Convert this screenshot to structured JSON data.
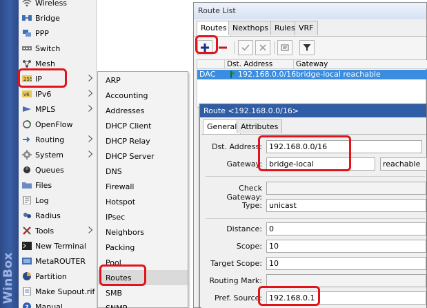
{
  "brand": {
    "text": "WinBox"
  },
  "main_menu": [
    {
      "label": "Wireless",
      "icon": "wireless-icon",
      "arrow": false
    },
    {
      "label": "Bridge",
      "icon": "bridge-icon",
      "arrow": false
    },
    {
      "label": "PPP",
      "icon": "ppp-icon",
      "arrow": false
    },
    {
      "label": "Switch",
      "icon": "switch-icon",
      "arrow": false
    },
    {
      "label": "Mesh",
      "icon": "mesh-icon",
      "arrow": false
    },
    {
      "label": "IP",
      "icon": "ip-icon",
      "arrow": true
    },
    {
      "label": "IPv6",
      "icon": "ipv6-icon",
      "arrow": true
    },
    {
      "label": "MPLS",
      "icon": "mpls-icon",
      "arrow": true
    },
    {
      "label": "OpenFlow",
      "icon": "openflow-icon",
      "arrow": false
    },
    {
      "label": "Routing",
      "icon": "routing-icon",
      "arrow": true
    },
    {
      "label": "System",
      "icon": "gear-icon",
      "arrow": true
    },
    {
      "label": "Queues",
      "icon": "queues-icon",
      "arrow": false
    },
    {
      "label": "Files",
      "icon": "folder-icon",
      "arrow": false
    },
    {
      "label": "Log",
      "icon": "log-icon",
      "arrow": false
    },
    {
      "label": "Radius",
      "icon": "radius-icon",
      "arrow": false
    },
    {
      "label": "Tools",
      "icon": "tools-icon",
      "arrow": true
    },
    {
      "label": "New Terminal",
      "icon": "terminal-icon",
      "arrow": false
    },
    {
      "label": "MetaROUTER",
      "icon": "metarouter-icon",
      "arrow": false
    },
    {
      "label": "Partition",
      "icon": "partition-icon",
      "arrow": false
    },
    {
      "label": "Make Supout.rif",
      "icon": "supout-icon",
      "arrow": false
    },
    {
      "label": "Manual",
      "icon": "help-icon",
      "arrow": false
    }
  ],
  "ip_submenu": [
    {
      "label": "ARP"
    },
    {
      "label": "Accounting"
    },
    {
      "label": "Addresses"
    },
    {
      "label": "DHCP Client"
    },
    {
      "label": "DHCP Relay"
    },
    {
      "label": "DHCP Server"
    },
    {
      "label": "DNS"
    },
    {
      "label": "Firewall"
    },
    {
      "label": "Hotspot"
    },
    {
      "label": "IPsec"
    },
    {
      "label": "Neighbors"
    },
    {
      "label": "Packing"
    },
    {
      "label": "Pool"
    },
    {
      "label": "Routes"
    },
    {
      "label": "SMB"
    },
    {
      "label": "SNMP"
    }
  ],
  "route_list": {
    "title": "Route List",
    "tabs": [
      "Routes",
      "Nexthops",
      "Rules",
      "VRF"
    ],
    "columns": [
      "",
      "Dst. Address",
      "Gateway"
    ],
    "rows": [
      {
        "flags": "DAC",
        "dst": "192.168.0.0/16",
        "gateway": "bridge-local reachable"
      }
    ]
  },
  "route_dialog": {
    "title": "Route <192.168.0.0/16>",
    "tabs": [
      "General",
      "Attributes"
    ],
    "fields": {
      "dst_label": "Dst. Address:",
      "dst_value": "192.168.0.0/16",
      "gateway_label": "Gateway:",
      "gateway_value": "bridge-local",
      "gateway_status": "reachable",
      "check_gateway_label": "Check Gateway:",
      "type_label": "Type:",
      "type_value": "unicast",
      "distance_label": "Distance:",
      "distance_value": "0",
      "scope_label": "Scope:",
      "scope_value": "10",
      "target_scope_label": "Target Scope:",
      "target_scope_value": "10",
      "routing_mark_label": "Routing Mark:",
      "pref_source_label": "Pref. Source:",
      "pref_source_value": "192.168.0.1"
    }
  },
  "colors": {
    "highlight": "#e0141c",
    "selection": "#3a8de0",
    "title_bar": "#2f5da6"
  }
}
